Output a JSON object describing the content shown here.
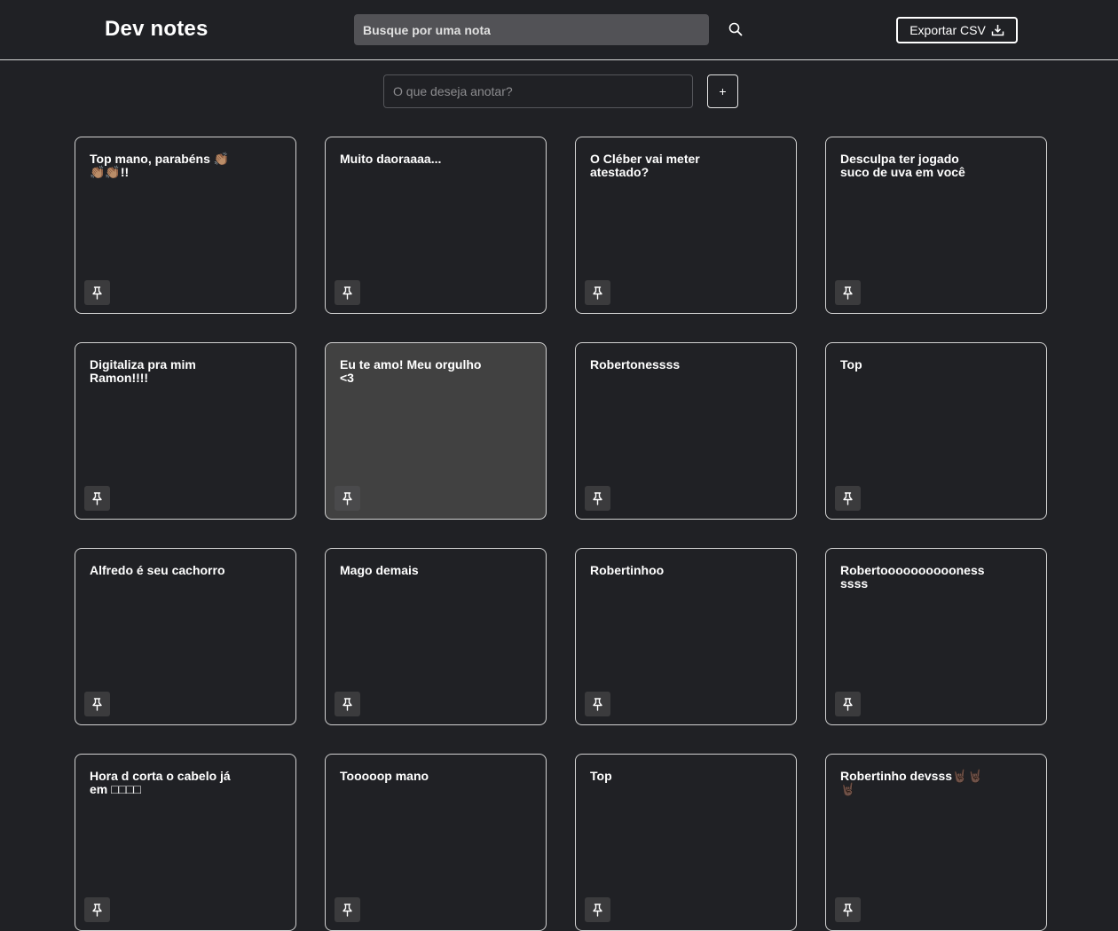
{
  "header": {
    "title": "Dev notes",
    "search_placeholder": "Busque por uma nota",
    "export_label": "Exportar CSV"
  },
  "composer": {
    "placeholder": "O que deseja anotar?",
    "add_label": "+"
  },
  "notes": [
    {
      "text": "Top mano, parabéns 👏🏽👏🏽👏🏽!!"
    },
    {
      "text": "Muito daoraaaa..."
    },
    {
      "text": "O Cléber vai meter atestado?"
    },
    {
      "text": "Desculpa ter jogado suco de uva em você"
    },
    {
      "text": "Digitaliza pra mim Ramon!!!!"
    },
    {
      "text": "Eu te amo! Meu orgulho <3",
      "highlighted": true
    },
    {
      "text": "Robertonessss"
    },
    {
      "text": "Top"
    },
    {
      "text": "Alfredo é seu cachorro"
    },
    {
      "text": "Mago demais"
    },
    {
      "text": "Robertinhoo"
    },
    {
      "text": "Robertoooooooooonessssss"
    },
    {
      "text": "Hora d corta o cabelo já em □□□□"
    },
    {
      "text": "Tooooop mano"
    },
    {
      "text": "Top"
    },
    {
      "text": "Robertinho devsss🤘🏿🤘🏿🤘🏿"
    }
  ],
  "icons": {
    "search": "search-icon",
    "export": "download-icon",
    "pin": "pin-icon"
  },
  "colors": {
    "background": "#202125",
    "search_bg": "#525256",
    "highlight_card": "#414141"
  }
}
